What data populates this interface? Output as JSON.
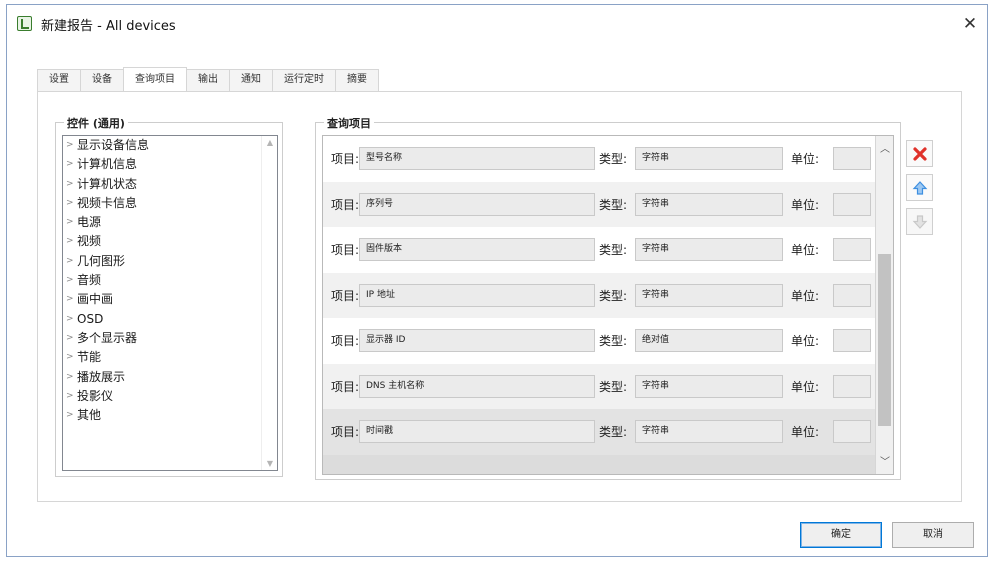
{
  "window": {
    "title": "新建报告 - All devices",
    "close_glyph": "✕"
  },
  "tabs": [
    {
      "label": "设置",
      "active": false
    },
    {
      "label": "设备",
      "active": false
    },
    {
      "label": "查询项目",
      "active": true
    },
    {
      "label": "输出",
      "active": false
    },
    {
      "label": "通知",
      "active": false
    },
    {
      "label": "运行定时",
      "active": false
    },
    {
      "label": "摘要",
      "active": false
    }
  ],
  "widgets": {
    "title": "控件 (通用)",
    "items": [
      "显示设备信息",
      "计算机信息",
      "计算机状态",
      "视频卡信息",
      "电源",
      "视频",
      "几何图形",
      "音频",
      "画中画",
      "OSD",
      "多个显示器",
      "节能",
      "播放展示",
      "投影仪",
      "其他"
    ]
  },
  "query": {
    "title": "查询项目",
    "item_label": "项目:",
    "type_label": "类型:",
    "unit_label": "单位:",
    "rows": [
      {
        "item": "型号名称",
        "type": "字符串",
        "unit": ""
      },
      {
        "item": "序列号",
        "type": "字符串",
        "unit": ""
      },
      {
        "item": "固件版本",
        "type": "字符串",
        "unit": ""
      },
      {
        "item": "IP 地址",
        "type": "字符串",
        "unit": ""
      },
      {
        "item": "显示器 ID",
        "type": "绝对值",
        "unit": ""
      },
      {
        "item": "DNS 主机名称",
        "type": "字符串",
        "unit": ""
      },
      {
        "item": "时间戳",
        "type": "字符串",
        "unit": ""
      }
    ]
  },
  "actions": {
    "delete_icon": "delete-x-icon",
    "move_up_icon": "arrow-up-icon",
    "move_down_icon": "arrow-down-icon"
  },
  "footer": {
    "ok_label": "确定",
    "cancel_label": "取消"
  },
  "colors": {
    "delete_red": "#e0322a",
    "arrow_blue": "#3d8fe0",
    "disabled_gray": "#c8c8c8",
    "focus_blue": "#0078d7"
  }
}
